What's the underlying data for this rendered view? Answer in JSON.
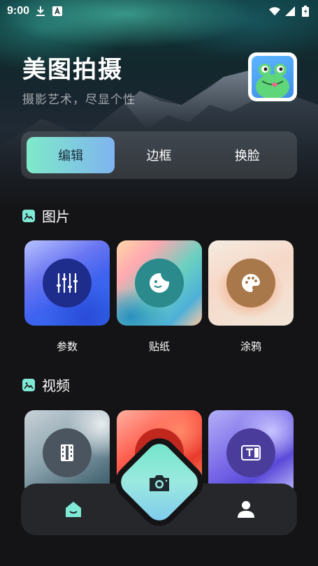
{
  "status_bar": {
    "time": "9:00",
    "icons": [
      "download-icon",
      "a-badge-icon",
      "wifi-icon",
      "signal-icon",
      "battery-icon"
    ]
  },
  "header": {
    "title": "美图拍摄",
    "subtitle": "摄影艺术，尽显个性",
    "avatar_icon": "frog-avatar"
  },
  "tabs": [
    {
      "label": "编辑",
      "active": true
    },
    {
      "label": "边框",
      "active": false
    },
    {
      "label": "换脸",
      "active": false
    }
  ],
  "sections": [
    {
      "title": "图片",
      "icon": "image-icon",
      "items": [
        {
          "label": "参数",
          "icon": "sliders-icon"
        },
        {
          "label": "贴纸",
          "icon": "sticker-icon"
        },
        {
          "label": "涂鸦",
          "icon": "palette-icon"
        }
      ]
    },
    {
      "title": "视频",
      "icon": "image-icon",
      "items": [
        {
          "label": "",
          "icon": "film-icon"
        },
        {
          "label": "",
          "icon": "sparkle-icon"
        },
        {
          "label": "",
          "icon": "text-icon"
        }
      ]
    }
  ],
  "bottom_nav": {
    "items": [
      "home-icon",
      "camera-icon",
      "profile-icon"
    ]
  },
  "colors": {
    "accent_start": "#7fe9c9",
    "accent_end": "#7fb4f0",
    "background": "#141416"
  }
}
